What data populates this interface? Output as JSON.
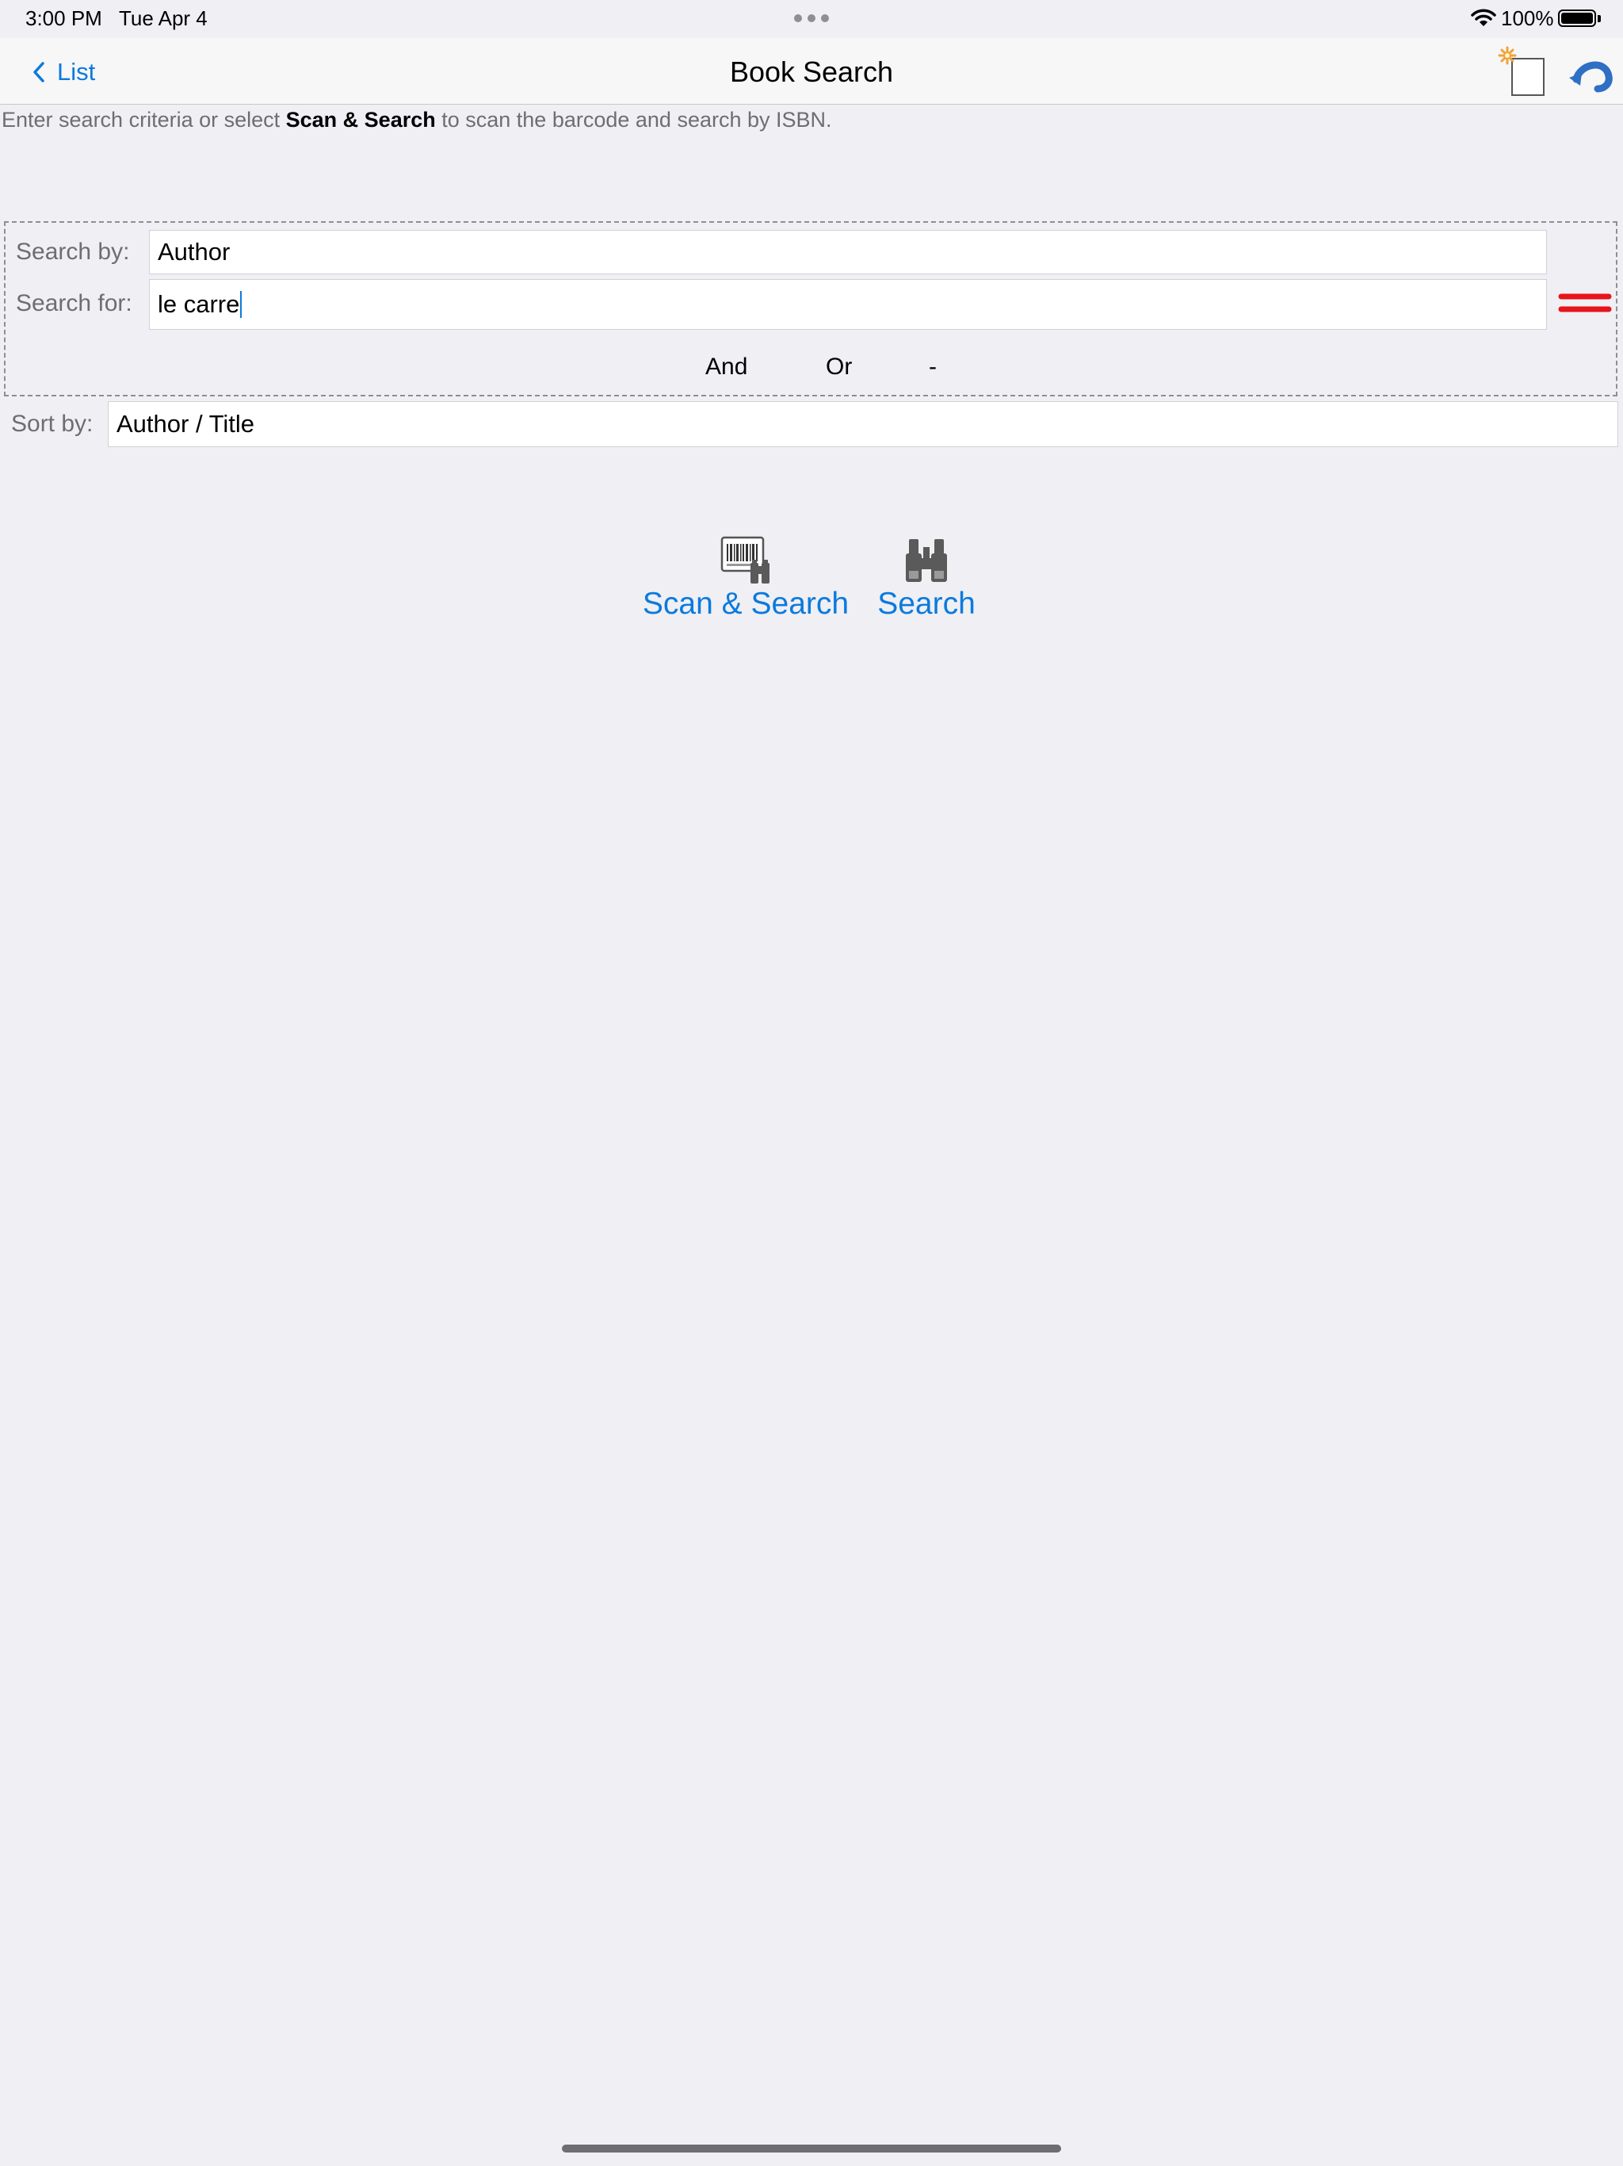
{
  "status_bar": {
    "time": "3:00 PM",
    "date": "Tue Apr 4",
    "battery_percent": "100%",
    "battery_level": 1.0,
    "icons": [
      "multitasking-dots-icon",
      "wifi-icon",
      "battery-icon"
    ]
  },
  "nav": {
    "back_label": "List",
    "title": "Book Search",
    "accent_color": "#0b7ade",
    "right_icons": [
      "new-document-icon",
      "undo-icon"
    ]
  },
  "hint": {
    "prefix": "Enter search criteria or select ",
    "bold": "Scan & Search",
    "suffix": " to scan the barcode and search by ISBN."
  },
  "criteria": {
    "search_by_label": "Search by:",
    "search_by_value": "Author",
    "search_for_label": "Search for:",
    "search_for_value": "le carre",
    "remove_icon_color": "#e8141b",
    "operators": [
      "And",
      "Or",
      "-"
    ]
  },
  "sort": {
    "label": "Sort by:",
    "value": "Author / Title"
  },
  "actions": {
    "scan_search_label": "Scan & Search",
    "search_label": "Search"
  }
}
